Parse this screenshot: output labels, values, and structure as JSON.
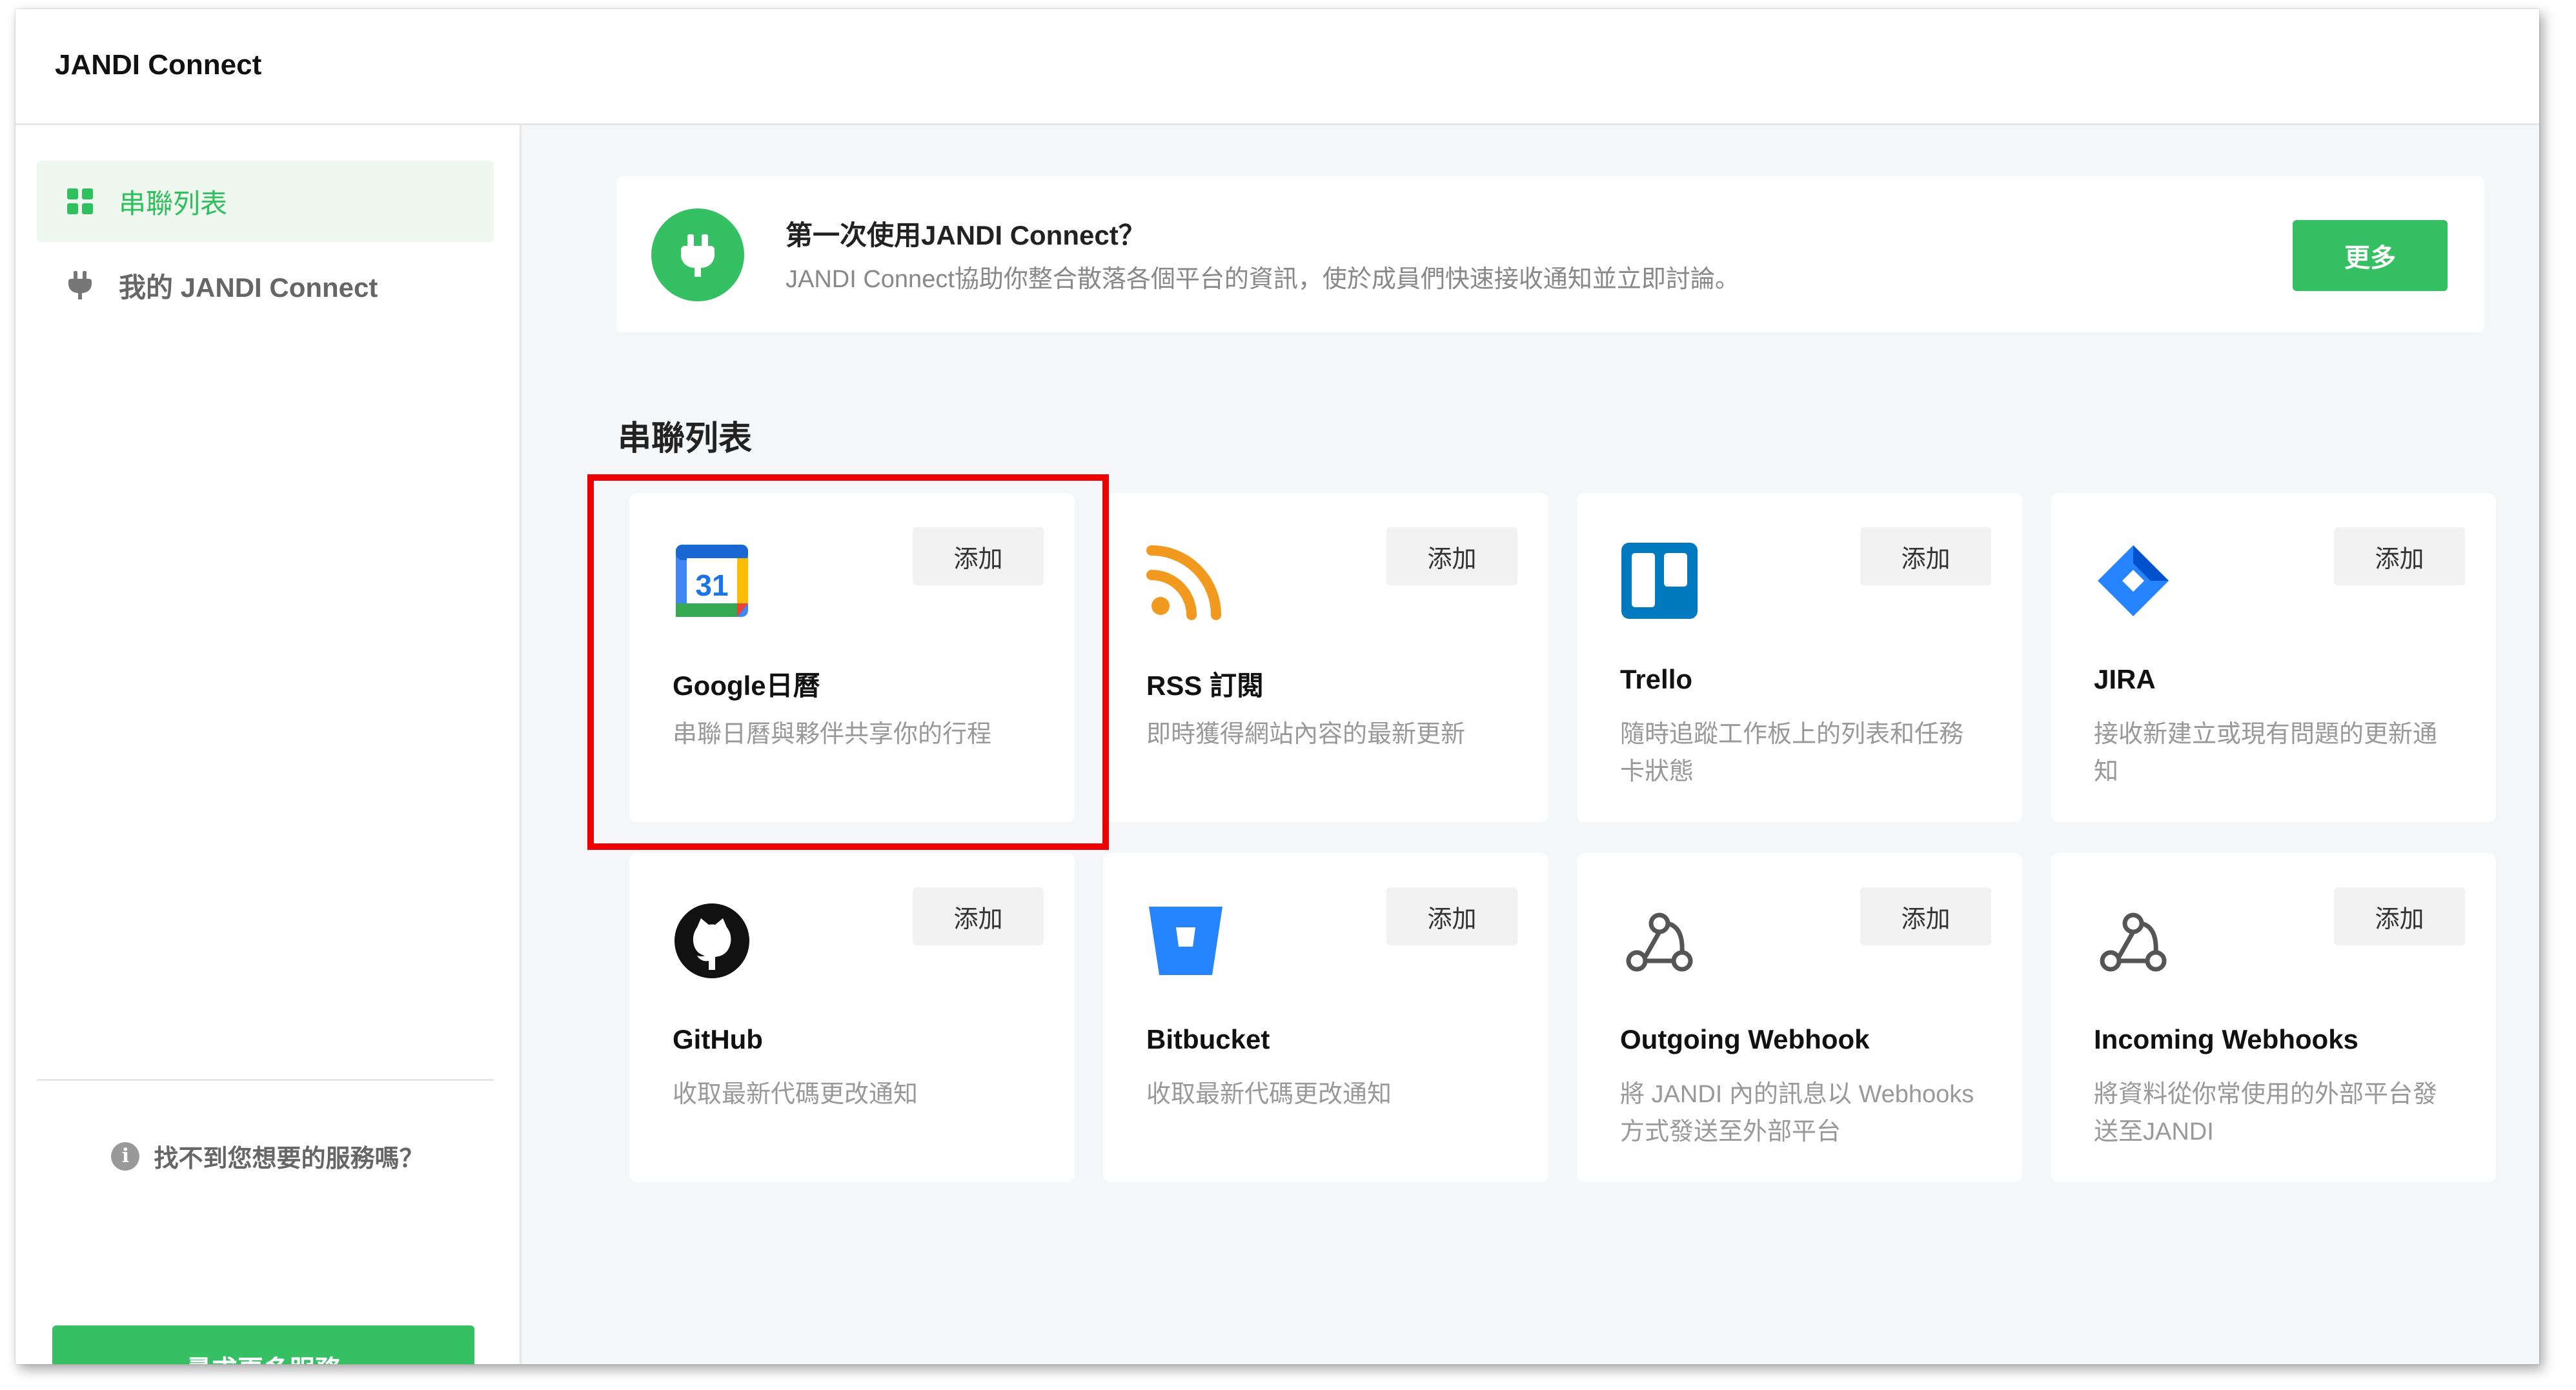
{
  "app": {
    "title": "JANDI Connect"
  },
  "sidebar": {
    "items": [
      {
        "label": "串聯列表",
        "icon": "grid-icon",
        "active": true
      },
      {
        "label": "我的 JANDI Connect",
        "icon": "plug-icon",
        "active": false
      }
    ],
    "help_text": "找不到您想要的服務嗎？",
    "more_services_label": "尋求更多服務"
  },
  "banner": {
    "title": "第一次使用JANDI Connect？",
    "description": "JANDI Connect協助你整合散落各個平台的資訊，使於成員們快速接收通知並立即討論。",
    "button_label": "更多"
  },
  "section": {
    "title": "串聯列表"
  },
  "connectors": [
    {
      "name": "Google日曆",
      "description": "串聯日曆與夥伴共享你的行程",
      "add_label": "添加",
      "icon": "google-calendar-icon"
    },
    {
      "name": "RSS 訂閱",
      "description": "即時獲得網站內容的最新更新",
      "add_label": "添加",
      "icon": "rss-icon"
    },
    {
      "name": "Trello",
      "description": "隨時追蹤工作板上的列表和任務卡狀態",
      "add_label": "添加",
      "icon": "trello-icon"
    },
    {
      "name": "JIRA",
      "description": "接收新建立或現有問題的更新通知",
      "add_label": "添加",
      "icon": "jira-icon"
    },
    {
      "name": "GitHub",
      "description": "收取最新代碼更改通知",
      "add_label": "添加",
      "icon": "github-icon"
    },
    {
      "name": "Bitbucket",
      "description": "收取最新代碼更改通知",
      "add_label": "添加",
      "icon": "bitbucket-icon"
    },
    {
      "name": "Outgoing Webhook",
      "description": "將 JANDI 內的訊息以 Webhooks 方式發送至外部平台",
      "add_label": "添加",
      "icon": "webhook-icon"
    },
    {
      "name": "Incoming Webhooks",
      "description": "將資料從你常使用的外部平台發送至JANDI",
      "add_label": "添加",
      "icon": "webhook-icon"
    }
  ],
  "colors": {
    "accent": "#35c063",
    "highlight": "#ee0000"
  },
  "callout_icon": "plug-icon"
}
